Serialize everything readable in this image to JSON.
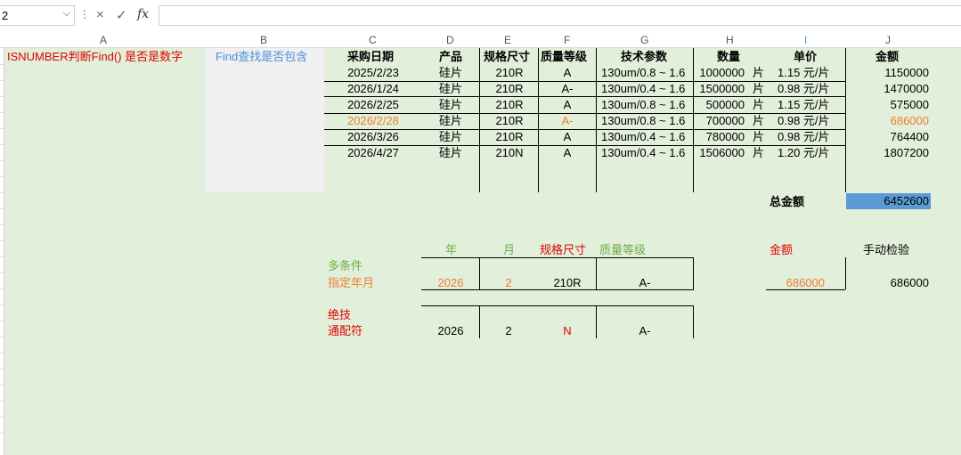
{
  "formula_bar": {
    "name_box": "2",
    "cancel_icon": "×",
    "enter_icon": "✓",
    "fx_icon": "fx",
    "formula": ""
  },
  "columns": [
    "A",
    "B",
    "C",
    "D",
    "E",
    "F",
    "G",
    "H",
    "I",
    "J"
  ],
  "labels": {
    "a_note": "ISNUMBER判断Find()  是否是数字",
    "b_note": "Find查找是否包含"
  },
  "table": {
    "headers": [
      "采购日期",
      "产品",
      "规格尺寸",
      "质量等级",
      "技术参数",
      "数量",
      "单价",
      "金额"
    ],
    "rows": [
      {
        "date": "2025/2/23",
        "product": "硅片",
        "size": "210R",
        "grade": "A",
        "param": "130um/0.8 ~ 1.6",
        "qty": "1000000",
        "unit": "片",
        "price": "1.15 元/片",
        "amount": "1150000"
      },
      {
        "date": "2026/1/24",
        "product": "硅片",
        "size": "210R",
        "grade": "A-",
        "param": "130um/0.4 ~ 1.6",
        "qty": "1500000",
        "unit": "片",
        "price": "0.98 元/片",
        "amount": "1470000"
      },
      {
        "date": "2026/2/25",
        "product": "硅片",
        "size": "210R",
        "grade": "A",
        "param": "130um/0.8 ~ 1.6",
        "qty": "500000",
        "unit": "片",
        "price": "1.15 元/片",
        "amount": "575000"
      },
      {
        "date": "2026/2/28",
        "product": "硅片",
        "size": "210R",
        "grade": "A-",
        "param": "130um/0.8 ~ 1.6",
        "qty": "700000",
        "unit": "片",
        "price": "0.98 元/片",
        "amount": "686000"
      },
      {
        "date": "2026/3/26",
        "product": "硅片",
        "size": "210R",
        "grade": "A",
        "param": "130um/0.4 ~ 1.6",
        "qty": "780000",
        "unit": "片",
        "price": "0.98 元/片",
        "amount": "764400"
      },
      {
        "date": "2026/4/27",
        "product": "硅片",
        "size": "210N",
        "grade": "A",
        "param": "130um/0.4 ~ 1.6",
        "qty": "1506000",
        "unit": "片",
        "price": "1.20 元/片",
        "amount": "1807200"
      }
    ],
    "total_label": "总金额",
    "total_value": "6452600"
  },
  "criteria": {
    "headers": {
      "year": "年",
      "month": "月",
      "size": "规格尺寸",
      "grade": "质量等级",
      "amount": "金额",
      "manual": "手动检验"
    },
    "multi_label_1": "多条件",
    "multi_label_2": "指定年月",
    "row1": {
      "year": "2026",
      "month": "2",
      "size": "210R",
      "grade": "A-",
      "amount": "686000",
      "manual": "686000"
    },
    "trick_label_1": "绝技",
    "trick_label_2": "通配符",
    "row2": {
      "year": "2026",
      "month": "2",
      "size": "N",
      "grade": "A-"
    }
  }
}
